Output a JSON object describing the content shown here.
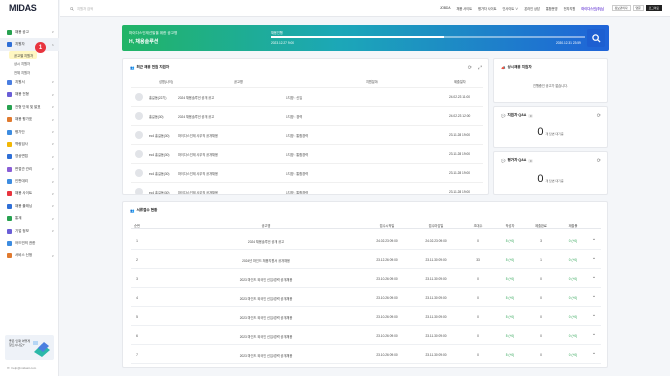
{
  "app": {
    "logo": "MIDAS"
  },
  "sidebar": {
    "items": [
      {
        "label": "채용 공고",
        "icon": "briefcase-icon",
        "color": "#27a150",
        "chev": "∨"
      },
      {
        "label": "지원자",
        "icon": "user-icon",
        "color": "#2f6fd6",
        "chev": "∧",
        "active": true
      },
      {
        "label": "지원서",
        "icon": "document-icon",
        "color": "#4a7ee0",
        "chev": "∨"
      },
      {
        "label": "채용 전형",
        "icon": "flow-icon",
        "color": "#6a5ed6",
        "chev": "∨"
      },
      {
        "label": "전형 단계 및 발표",
        "icon": "steps-icon",
        "color": "#27a150",
        "chev": "∨"
      },
      {
        "label": "채용 평가표",
        "icon": "clipboard-icon",
        "color": "#e07a2f",
        "chev": "∨"
      },
      {
        "label": "평가단",
        "icon": "group-icon",
        "color": "#3d8ce0",
        "chev": "∨"
      },
      {
        "label": "역량검사",
        "icon": "brain-icon",
        "color": "#f2b705",
        "chev": "∨"
      },
      {
        "label": "영상면접",
        "icon": "video-icon",
        "color": "#2f6fd6",
        "chev": "∨"
      },
      {
        "label": "면접관 관리",
        "icon": "interviewer-icon",
        "color": "#8a5ed6",
        "chev": "∨"
      },
      {
        "label": "인판대리",
        "icon": "mail-icon",
        "color": "#3d8ce0",
        "chev": "∨"
      },
      {
        "label": "채용 사이트",
        "icon": "site-icon",
        "color": "#e8343e",
        "chev": "∨"
      },
      {
        "label": "채용 플래닝",
        "icon": "calendar-icon",
        "color": "#2f6fd6",
        "chev": "∨"
      },
      {
        "label": "통계",
        "icon": "chart-icon",
        "color": "#27a150",
        "chev": "∨"
      },
      {
        "label": "기업 정보",
        "icon": "building-icon",
        "color": "#6a5ed6",
        "chev": "∨"
      },
      {
        "label": "어드민의 권한",
        "icon": "admin-icon",
        "color": "#3d8ce0",
        "chev": ""
      },
      {
        "label": "서비스 신청",
        "icon": "service-icon",
        "color": "#e07a2f",
        "chev": "∨"
      }
    ],
    "subitems": [
      "공고별 지원자",
      "상시 지원자",
      "전체 지원자"
    ],
    "callout": "1",
    "promo_text": "좋은 인재 어떻게 찾으시나요?",
    "footer": "help@midasit.com"
  },
  "topbar": {
    "search_placeholder": "지원자 검색",
    "links": [
      "JOBDA",
      "채용 사이트",
      "평가자 사이트",
      "인사이트 ∨",
      "온라인 상담",
      "통합운영",
      "전자지원"
    ],
    "highlight": "마이다스인(주)님",
    "buttons": [
      "정보관리자",
      "영문",
      "로그아웃"
    ]
  },
  "banner": {
    "line1": "마이다스인재선발을 위한 공고명",
    "line2": "H, 채용솔루션",
    "progress_label": "채용진행",
    "progress": 0.55,
    "start": "2023.12.27 9:00",
    "end": "2030.12.31 23:59"
  },
  "recent": {
    "title": "최근 채용 전원 지원자",
    "count": "",
    "columns": [
      "성명(나이)",
      "공고명",
      "지원분야",
      "제출일자"
    ],
    "rows": [
      [
        "홍길동(22기)",
        "2024 채용솔루션 공개 공고",
        "1지망 : 신입",
        "24.02.23 11:00"
      ],
      [
        "홍길동(30)",
        "2024 채용솔루션 공개 공고",
        "1지망 : 경력",
        "24.02.23 12:00"
      ],
      [
        "ec4 홍길동(30)",
        "마이다스인재 사무직 공개채용",
        "1지망 : 통합경력",
        "23.11.28 19:00"
      ],
      [
        "ec4 홍길동(30)",
        "마이다스인재 사무직 공개채용",
        "1지망 : 통합경력",
        "23.11.28 19:00"
      ],
      [
        "ec4 홍길동(30)",
        "마이다스인재 사무직 공개채용",
        "1지망 : 통합경력",
        "23.11.28 19:00"
      ],
      [
        "ec4 홍길동(30)",
        "마이다스인재 사무직 공개채용",
        "1지망 : 통합경력",
        "23.11.28 19:00"
      ],
      [
        "ec4 홍길동(30)",
        "마이다스인재 사무직 공개채용",
        "1지망 : 통합경력",
        "23.11.28 19:00"
      ]
    ]
  },
  "always": {
    "title": "상시채용 지원자",
    "empty": "진행중인 공고가 없습니다."
  },
  "qa_applicant": {
    "title": "지원자 Q&A",
    "count": "0",
    "value": "0",
    "sub": "개 답변 대기중"
  },
  "qa_evaluator": {
    "title": "평가자 Q&A",
    "count": "0",
    "value": "0",
    "sub": "개 답변 대기중"
  },
  "status": {
    "title": "서류접수 현황",
    "columns": [
      "순번",
      "공고명",
      "접수시작일",
      "접수마감일",
      "초대수",
      "작성자",
      "제출완료",
      "제출률"
    ],
    "rows": [
      [
        "1",
        "2024 채용솔루션 공개 공고",
        "24.02.23 09:00",
        "24.02.23 09:00",
        "0",
        "5 (+0)",
        "3",
        "0 (+0)"
      ],
      [
        "2",
        "2024년 마인드 채용지원서 공개채용",
        "23.12.26 09:00",
        "23.11.30 09:00",
        "33",
        "5 (+0)",
        "1",
        "0 (+0)"
      ],
      [
        "3",
        "2023 마인드 외국인 신입/경력 공개채용",
        "23.10.26 09:00",
        "23.11.30 09:00",
        "0",
        "5 (+0)",
        "0",
        "0 (+0)"
      ],
      [
        "4",
        "2023 마인드 외국인 신입/경력 공개채용",
        "23.10.26 09:00",
        "23.11.30 09:00",
        "0",
        "5 (+0)",
        "0",
        "0 (+0)"
      ],
      [
        "5",
        "2023 마인드 외국인 신입/경력 공개채용",
        "23.10.26 09:00",
        "23.11.30 09:00",
        "0",
        "5 (+0)",
        "0",
        "0 (+0)"
      ],
      [
        "6",
        "2023 마인드 외국인 신입/경력 공개채용",
        "23.10.26 09:00",
        "23.11.30 09:00",
        "0",
        "5 (+0)",
        "0",
        "0 (+0)"
      ],
      [
        "7",
        "2023 마인드 외국인 신입/경력 공개채용",
        "23.10.26 09:00",
        "23.11.30 09:00",
        "0",
        "5 (+0)",
        "0",
        "0 (+0)"
      ]
    ]
  },
  "colors": {
    "accent": "#1f63d8",
    "brand_green": "#21b466",
    "callout": "#e8343e",
    "highlight": "#fff7c2"
  }
}
